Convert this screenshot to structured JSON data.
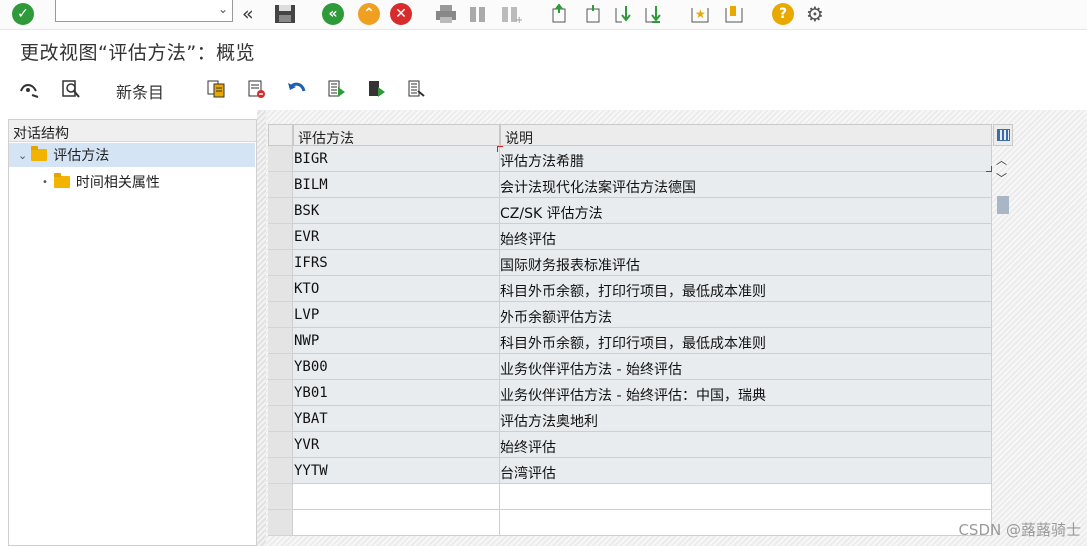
{
  "toolbar": {
    "command_field_value": "",
    "icons": [
      "check-icon",
      "command-field",
      "dropdown-icon",
      "back-double-icon",
      "save-icon",
      "back-icon",
      "exit-icon",
      "cancel-icon",
      "print-icon",
      "find-icon",
      "find-next-icon",
      "first-page-icon",
      "prev-page-icon",
      "next-page-icon",
      "last-page-icon",
      "create-shortcut-icon",
      "bookmark-icon",
      "help-icon",
      "settings-icon"
    ],
    "colors": {
      "green": "#2e9a3a",
      "orange": "#f0a020",
      "red": "#d82c2c",
      "help": "#e8a800"
    }
  },
  "title": "更改视图“评估方法”：概览",
  "app_toolbar": {
    "new_entries": "新条目",
    "icons": [
      "display-change-icon",
      "details-icon",
      "copy-icon",
      "delete-icon",
      "undo-icon",
      "select-all-icon",
      "select-block-icon",
      "deselect-all-icon"
    ]
  },
  "tree": {
    "header": "对话结构",
    "nodes": [
      {
        "label": "评估方法",
        "selected": true
      },
      {
        "label": "时间相关属性",
        "selected": false
      }
    ]
  },
  "table": {
    "columns": [
      "评估方法",
      "说明"
    ],
    "rows": [
      {
        "code": "BIGR",
        "desc": "评估方法希腊"
      },
      {
        "code": "BILM",
        "desc": "会计法现代化法案评估方法德国"
      },
      {
        "code": "BSK",
        "desc": "CZ/SK 评估方法"
      },
      {
        "code": "EVR",
        "desc": "始终评估"
      },
      {
        "code": "IFRS",
        "desc": "国际财务报表标准评估"
      },
      {
        "code": "KTO",
        "desc": "科目外币余额，打印行项目，最低成本准则"
      },
      {
        "code": "LVP",
        "desc": "外币余额评估方法"
      },
      {
        "code": "NWP",
        "desc": "科目外币余额，打印行项目，最低成本准则"
      },
      {
        "code": "YB00",
        "desc": "业务伙伴评估方法 - 始终评估"
      },
      {
        "code": "YB01",
        "desc": "业务伙伴评估方法 - 始终评估：中国，瑞典"
      },
      {
        "code": "YBAT",
        "desc": "评估方法奥地利"
      },
      {
        "code": "YVR",
        "desc": "始终评估"
      },
      {
        "code": "YYTW",
        "desc": "台湾评估"
      }
    ],
    "empty_rows": 2
  },
  "watermark": "CSDN @蕗蕗骑士"
}
